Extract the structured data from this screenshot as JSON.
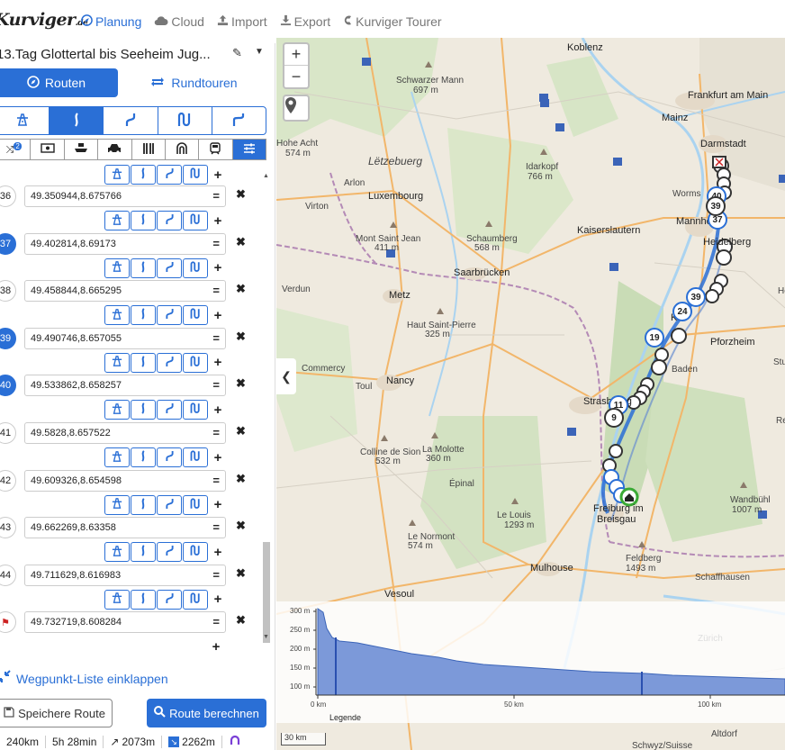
{
  "app": {
    "logo": "Kurviger",
    "logo_suffix": ".de"
  },
  "nav": [
    {
      "label": "Planung",
      "icon": "compass-icon"
    },
    {
      "label": "Cloud",
      "icon": "cloud-icon"
    },
    {
      "label": "Import",
      "icon": "upload-icon"
    },
    {
      "label": "Export",
      "icon": "download-icon"
    },
    {
      "label": "Kurviger Tourer",
      "icon": "kurviger-icon"
    }
  ],
  "route": {
    "title": "13.Tag Glottertal bis Seeheim Jug..."
  },
  "tabs": {
    "routen": "Routen",
    "rundtouren": "Rundtouren"
  },
  "waypoints": [
    {
      "num": "36",
      "coords": "49.350944,8.675766",
      "blue": false
    },
    {
      "num": "37",
      "coords": "49.402814,8.69173",
      "blue": true
    },
    {
      "num": "38",
      "coords": "49.458844,8.665295",
      "blue": false
    },
    {
      "num": "39",
      "coords": "49.490746,8.657055",
      "blue": true
    },
    {
      "num": "40",
      "coords": "49.533862,8.658257",
      "blue": true
    },
    {
      "num": "41",
      "coords": "49.5828,8.657522",
      "blue": false
    },
    {
      "num": "42",
      "coords": "49.609326,8.654598",
      "blue": false
    },
    {
      "num": "43",
      "coords": "49.662269,8.63358",
      "blue": false
    },
    {
      "num": "44",
      "coords": "49.711629,8.616983",
      "blue": false
    },
    {
      "num": "",
      "coords": "49.732719,8.608284",
      "blue": false
    }
  ],
  "actions": {
    "collapse": "Wegpunkt-Liste einklappen",
    "save": "Speichere Route",
    "calculate": "Route berechnen"
  },
  "stats": {
    "distance": "240km",
    "duration": "5h 28min",
    "ascent": "2073m",
    "descent": "2262m"
  },
  "map": {
    "labels": [
      {
        "t": "Koblenz",
        "x": 323,
        "y": 5,
        "c": "big"
      },
      {
        "t": "Frankfurt am Main",
        "x": 457,
        "y": 58,
        "c": "big"
      },
      {
        "t": "Mainz",
        "x": 428,
        "y": 83,
        "c": "big"
      },
      {
        "t": "Darmstadt",
        "x": 471,
        "y": 112,
        "c": "big"
      },
      {
        "t": "Schwarzer Mann",
        "x": 133,
        "y": 42,
        "c": ""
      },
      {
        "t": "697 m",
        "x": 152,
        "y": 53,
        "c": ""
      },
      {
        "t": "Idarkopf",
        "x": 277,
        "y": 138,
        "c": ""
      },
      {
        "t": "766 m",
        "x": 279,
        "y": 149,
        "c": ""
      },
      {
        "t": "Lëtzebuerg",
        "x": 102,
        "y": 130,
        "c": "italic"
      },
      {
        "t": "Luxembourg",
        "x": 102,
        "y": 170,
        "c": "big"
      },
      {
        "t": "Kaiserslautern",
        "x": 334,
        "y": 208,
        "c": "big"
      },
      {
        "t": "Worms",
        "x": 440,
        "y": 168,
        "c": ""
      },
      {
        "t": "Mannheim",
        "x": 444,
        "y": 198,
        "c": "big"
      },
      {
        "t": "Heidelberg",
        "x": 474,
        "y": 221,
        "c": "big"
      },
      {
        "t": "Mont Saint Jean",
        "x": 88,
        "y": 218,
        "c": ""
      },
      {
        "t": "411 m",
        "x": 109,
        "y": 228,
        "c": ""
      },
      {
        "t": "Schaumberg",
        "x": 211,
        "y": 218,
        "c": ""
      },
      {
        "t": "568 m",
        "x": 220,
        "y": 228,
        "c": ""
      },
      {
        "t": "Saarbrücken",
        "x": 197,
        "y": 255,
        "c": "big"
      },
      {
        "t": "Verdun",
        "x": 6,
        "y": 274,
        "c": ""
      },
      {
        "t": "Metz",
        "x": 125,
        "y": 280,
        "c": "big"
      },
      {
        "t": "Haut Saint-Pierre",
        "x": 145,
        "y": 314,
        "c": ""
      },
      {
        "t": "325 m",
        "x": 165,
        "y": 324,
        "c": ""
      },
      {
        "t": "Pforzheim",
        "x": 482,
        "y": 332,
        "c": "big"
      },
      {
        "t": "Baden",
        "x": 439,
        "y": 363,
        "c": ""
      },
      {
        "t": "Commercy",
        "x": 28,
        "y": 362,
        "c": ""
      },
      {
        "t": "Nancy",
        "x": 122,
        "y": 375,
        "c": "big"
      },
      {
        "t": "Toul",
        "x": 88,
        "y": 382,
        "c": ""
      },
      {
        "t": "Strasbourg",
        "x": 341,
        "y": 398,
        "c": "big"
      },
      {
        "t": "Colline de Sion",
        "x": 93,
        "y": 455,
        "c": ""
      },
      {
        "t": "532 m",
        "x": 110,
        "y": 465,
        "c": ""
      },
      {
        "t": "La Molotte",
        "x": 162,
        "y": 452,
        "c": ""
      },
      {
        "t": "360 m",
        "x": 166,
        "y": 462,
        "c": ""
      },
      {
        "t": "Épinal",
        "x": 192,
        "y": 490,
        "c": ""
      },
      {
        "t": "Le Louis",
        "x": 245,
        "y": 525,
        "c": ""
      },
      {
        "t": "1293 m",
        "x": 253,
        "y": 536,
        "c": ""
      },
      {
        "t": "Freiburg im",
        "x": 352,
        "y": 517,
        "c": "big"
      },
      {
        "t": "Breisgau",
        "x": 356,
        "y": 529,
        "c": "big"
      },
      {
        "t": "Wandbühl",
        "x": 504,
        "y": 508,
        "c": ""
      },
      {
        "t": "1007 m",
        "x": 506,
        "y": 519,
        "c": ""
      },
      {
        "t": "Le Normont",
        "x": 146,
        "y": 549,
        "c": ""
      },
      {
        "t": "574 m",
        "x": 146,
        "y": 559,
        "c": ""
      },
      {
        "t": "Mulhouse",
        "x": 282,
        "y": 583,
        "c": "big"
      },
      {
        "t": "Feldberg",
        "x": 388,
        "y": 573,
        "c": ""
      },
      {
        "t": "1493 m",
        "x": 388,
        "y": 584,
        "c": ""
      },
      {
        "t": "Schaffhausen",
        "x": 465,
        "y": 594,
        "c": ""
      },
      {
        "t": "Vesoul",
        "x": 120,
        "y": 612,
        "c": "big"
      },
      {
        "t": "Zürich",
        "x": 468,
        "y": 662,
        "c": ""
      },
      {
        "t": "Altdorf",
        "x": 483,
        "y": 768,
        "c": ""
      },
      {
        "t": "Schwyz/Suisse",
        "x": 395,
        "y": 781,
        "c": ""
      },
      {
        "t": "Virton",
        "x": 32,
        "y": 182,
        "c": ""
      },
      {
        "t": "Arlon",
        "x": 75,
        "y": 156,
        "c": ""
      },
      {
        "t": "Hohe Acht",
        "x": 0,
        "y": 112,
        "c": ""
      },
      {
        "t": "574 m",
        "x": 10,
        "y": 123,
        "c": ""
      },
      {
        "t": "Stu",
        "x": 552,
        "y": 355,
        "c": ""
      },
      {
        "t": "Re",
        "x": 555,
        "y": 420,
        "c": ""
      },
      {
        "t": "He",
        "x": 557,
        "y": 276,
        "c": ""
      },
      {
        "t": "Ka",
        "x": 438,
        "y": 305,
        "c": "big"
      }
    ],
    "markers": [
      {
        "t": "24",
        "x": 451,
        "y": 304,
        "blue": true
      },
      {
        "t": "19",
        "x": 420,
        "y": 333,
        "blue": true
      },
      {
        "t": "11",
        "x": 380,
        "y": 408,
        "blue": true
      },
      {
        "t": "9",
        "x": 375,
        "y": 422,
        "blue": false
      },
      {
        "t": "39",
        "x": 466,
        "y": 288,
        "blue": true
      },
      {
        "t": "37",
        "x": 490,
        "y": 202,
        "blue": true
      },
      {
        "t": "40",
        "x": 489,
        "y": 176,
        "blue": true
      },
      {
        "t": "39",
        "x": 488,
        "y": 187,
        "blue": false
      }
    ]
  },
  "elevation": {
    "y_ticks": [
      "300 m",
      "250 m",
      "200 m",
      "150 m",
      "100 m"
    ],
    "x_ticks": [
      "0 km",
      "50 km",
      "100 km"
    ],
    "legend": "Legende"
  },
  "scale": "30 km"
}
